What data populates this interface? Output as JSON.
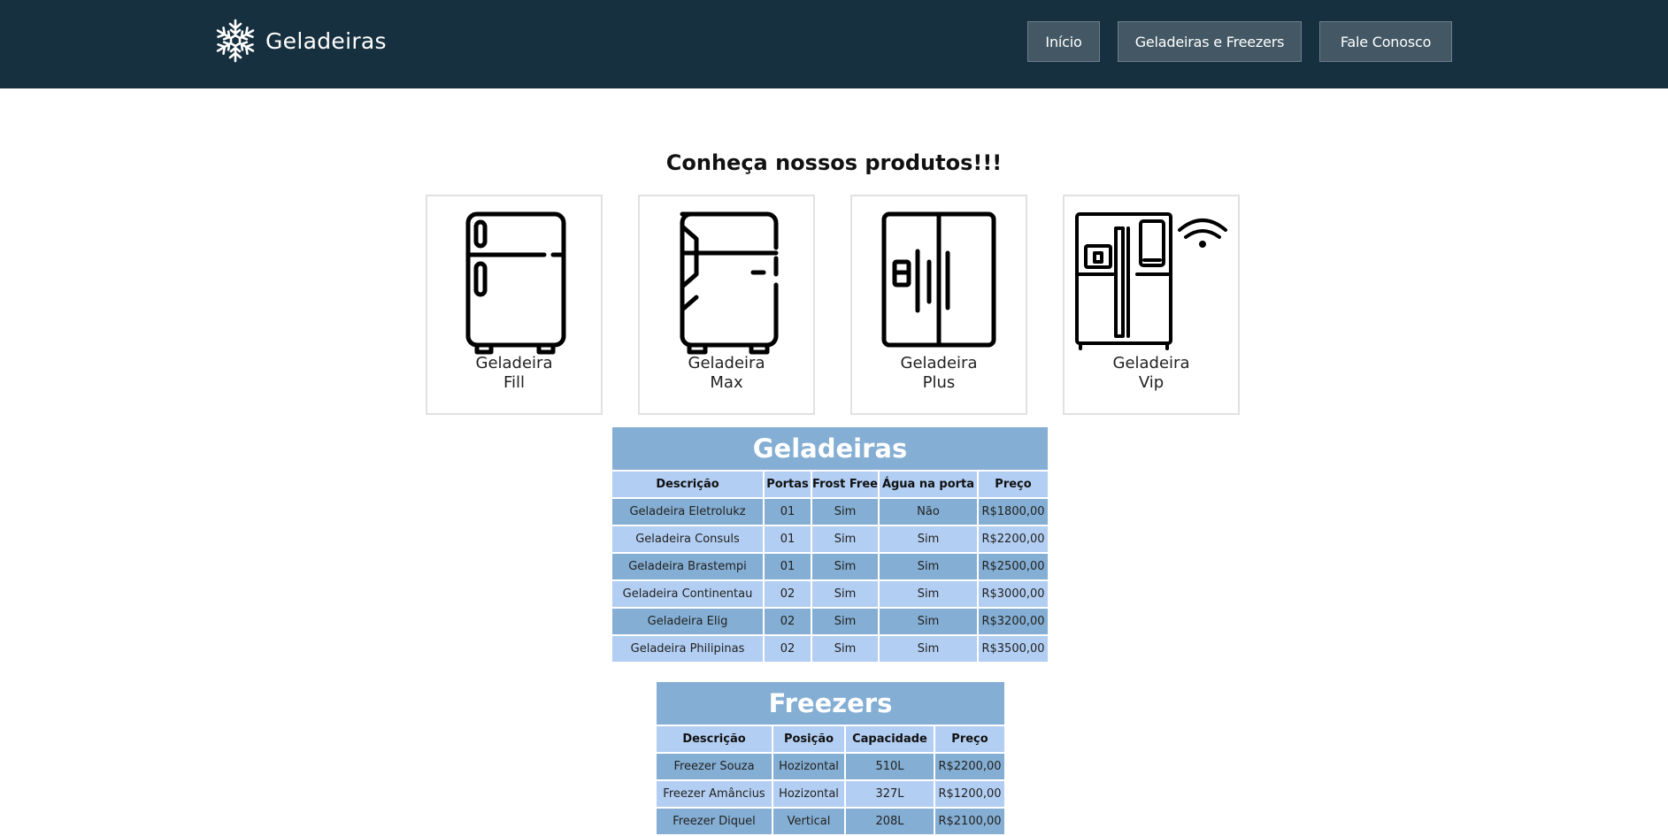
{
  "header": {
    "brand": "Geladeiras",
    "brand_icon": "snowflake-icon",
    "nav": [
      {
        "label": "Início"
      },
      {
        "label": "Geladeiras e Freezers"
      },
      {
        "label": "Fale Conosco"
      }
    ]
  },
  "colors": {
    "header_bg": "#17303f",
    "nav_button_bg": "#435864",
    "table_dark": "#84aed3",
    "table_light": "#b2cef2"
  },
  "main": {
    "headline": "Conheça nossos produtos!!!",
    "products": [
      {
        "name": "Geladeira",
        "model": "Fill",
        "icon": "fridge-icon"
      },
      {
        "name": "Geladeira",
        "model": "Max",
        "icon": "fridge-icon"
      },
      {
        "name": "Geladeira",
        "model": "Plus",
        "icon": "side-by-side-fridge-icon"
      },
      {
        "name": "Geladeira",
        "model": "Vip",
        "icon": "smart-fridge-wifi-icon"
      }
    ]
  },
  "geladeiras_table": {
    "title": "Geladeiras",
    "headers": [
      "Descrição",
      "Portas",
      "Frost Free",
      "Água na porta",
      "Preço"
    ],
    "rows": [
      [
        "Geladeira Eletrolukz",
        "01",
        "Sim",
        "Não",
        "R$1800,00"
      ],
      [
        "Geladeira Consuls",
        "01",
        "Sim",
        "Sim",
        "R$2200,00"
      ],
      [
        "Geladeira Brastempi",
        "01",
        "Sim",
        "Sim",
        "R$2500,00"
      ],
      [
        "Geladeira Continentau",
        "02",
        "Sim",
        "Sim",
        "R$3000,00"
      ],
      [
        "Geladeira Elig",
        "02",
        "Sim",
        "Sim",
        "R$3200,00"
      ],
      [
        "Geladeira Philipinas",
        "02",
        "Sim",
        "Sim",
        "R$3500,00"
      ]
    ]
  },
  "freezers_table": {
    "title": "Freezers",
    "headers": [
      "Descrição",
      "Posição",
      "Capacidade",
      "Preço"
    ],
    "rows": [
      [
        "Freezer Souza",
        "Hozizontal",
        "510L",
        "R$2200,00"
      ],
      [
        "Freezer Amâncius",
        "Hozizontal",
        "327L",
        "R$1200,00"
      ],
      [
        "Freezer Diquel",
        "Vertical",
        "208L",
        "R$2100,00"
      ]
    ]
  }
}
